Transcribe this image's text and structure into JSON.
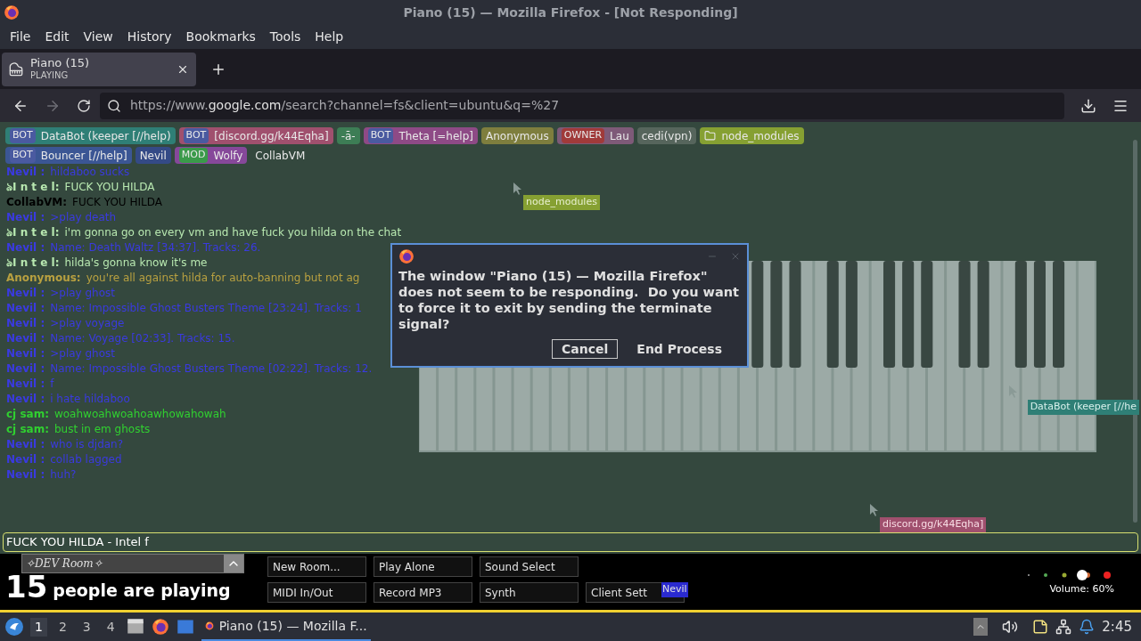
{
  "window": {
    "title": "Piano (15) — Mozilla Firefox - [Not Responding]"
  },
  "menu": [
    "File",
    "Edit",
    "View",
    "History",
    "Bookmarks",
    "Tools",
    "Help"
  ],
  "tab": {
    "title": "Piano (15)",
    "status": "PLAYING"
  },
  "url": {
    "domain_prefix": "https://www.",
    "domain": "google.com",
    "rest": "/search?channel=fs&client=ubuntu&q=%27"
  },
  "user_tags": [
    [
      {
        "badge": "BOT",
        "name": "DataBot (keeper [//help)",
        "color": "#2f7f76"
      },
      {
        "badge": "BOT",
        "name": "[discord.gg/k44Eqha]",
        "color": "#a0506e"
      },
      {
        "name": "-ā-",
        "color": "#3d7d55"
      },
      {
        "badge": "BOT",
        "name": "Theta [=help]",
        "color": "#8e4a86"
      },
      {
        "name": "Anonymous",
        "color": "#7e7e3e"
      },
      {
        "badge": "OWNER",
        "name": "Lau",
        "color": "#7e5a78"
      },
      {
        "name": "cedi(vpn)",
        "color": "#56655c"
      },
      {
        "name": "node_modules",
        "color": "#86a032",
        "folder": true
      }
    ],
    [
      {
        "badge": "BOT",
        "name": "Bouncer [//help]",
        "color": "#3b5694"
      },
      {
        "name": "Nevil",
        "color": "#344a86"
      },
      {
        "badge": "MOD",
        "name": "Wolfy",
        "color": "#86489a"
      },
      {
        "name": "CollabVM"
      }
    ]
  ],
  "chat": [
    {
      "name": "Nevil :",
      "text": "hildaboo sucks",
      "color": "#3a3ae0"
    },
    {
      "name": "ঌI n t e l:",
      "text": "FUCK YOU HILDA",
      "color": "#b8e8b0"
    },
    {
      "name": "CollabVM:",
      "text": "FUCK YOU HILDA",
      "color": "#000000"
    },
    {
      "name": "Nevil :",
      "text": ">play death",
      "color": "#3a3ae0"
    },
    {
      "name": "ঌI n t e l:",
      "text": "i'm gonna go on every vm and have fuck you hilda on the chat",
      "color": "#b8e8b0"
    },
    {
      "name": "Nevil :",
      "text": "Name: Death Waltz [34:37]. Tracks: 26.",
      "color": "#3a3ae0"
    },
    {
      "name": "ঌI n t e l:",
      "text": "hilda's gonna know it's me",
      "color": "#b8e8b0"
    },
    {
      "name": "Anonymous:",
      "text": "you're all against hilda for auto-banning but not ag",
      "color": "#b8a040"
    },
    {
      "name": "Nevil :",
      "text": ">play ghost",
      "color": "#3a3ae0"
    },
    {
      "name": "Nevil :",
      "text": "Name: Impossible Ghost Busters Theme [23:24]. Tracks: 1",
      "color": "#3a3ae0"
    },
    {
      "name": "Nevil :",
      "text": ">play voyage",
      "color": "#3a3ae0"
    },
    {
      "name": "Nevil :",
      "text": "Name: Voyage [02:33]. Tracks: 15.",
      "color": "#3a3ae0"
    },
    {
      "name": "Nevil :",
      "text": ">play ghost",
      "color": "#3a3ae0"
    },
    {
      "name": "Nevil :",
      "text": "Name: Impossible Ghost Busters Theme [02:22]. Tracks: 12.",
      "color": "#3a3ae0"
    },
    {
      "name": "Nevil :",
      "text": "f",
      "color": "#3a3ae0"
    },
    {
      "name": "Nevil :",
      "text": "i hate hildaboo",
      "color": "#3a3ae0"
    },
    {
      "name": "cj sam:",
      "text": "woahwoahwoahoawhowahowah",
      "color": "#30d030"
    },
    {
      "name": "cj sam:",
      "text": "bust in em ghosts",
      "color": "#30d030"
    },
    {
      "name": "Nevil :",
      "text": "who is djdan?",
      "color": "#3a3ae0"
    },
    {
      "name": "Nevil :",
      "text": "collab lagged",
      "color": "#3a3ae0"
    },
    {
      "name": "Nevil :",
      "text": "huh?",
      "color": "#3a3ae0"
    }
  ],
  "cursor_labels": [
    {
      "text": "node_modules",
      "color": "#86a032"
    },
    {
      "text": "DataBot (keeper [//he",
      "color": "#2f7f76"
    },
    {
      "text": "discord.gg/k44Eqha]",
      "color": "#a0506e"
    }
  ],
  "chat_input": {
    "value": "FUCK YOU HILDA - Intel f"
  },
  "dialog": {
    "message": "The window \"Piano (15) — Mozilla Firefox\" does not seem to be responding.  Do you want to force it to exit by sending the terminate signal?",
    "buttons": [
      {
        "label": "Cancel",
        "selected": true
      },
      {
        "label": "End Process",
        "selected": false
      }
    ]
  },
  "room": {
    "name": "✧DEV Room✧"
  },
  "player_count": {
    "number": "15",
    "label": "people are playing"
  },
  "buttons": [
    [
      "New Room...",
      "Play Alone",
      "Sound Select"
    ],
    [
      "MIDI In/Out",
      "Record MP3",
      "Synth",
      "Client Sett"
    ]
  ],
  "cursor_name": "Nevil",
  "volume": {
    "level": 0.6,
    "label": "Volume: 60%"
  },
  "taskbar": {
    "workspaces": [
      {
        "label": "1",
        "selected": true
      },
      {
        "label": "2",
        "selected": false
      },
      {
        "label": "3",
        "selected": false
      },
      {
        "label": "4",
        "selected": false
      }
    ],
    "task": "Piano (15) — Mozilla F...",
    "clock": "2:45"
  }
}
